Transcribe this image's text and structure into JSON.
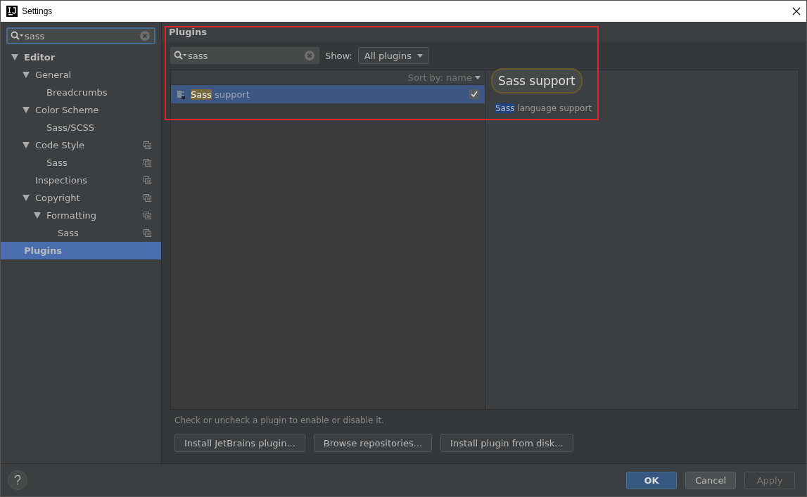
{
  "window": {
    "title": "Settings"
  },
  "search": {
    "value": "sass"
  },
  "tree": [
    {
      "label": "Editor",
      "expanded": true,
      "project_level": false,
      "selected": false,
      "children": [
        {
          "label": "General",
          "expanded": true,
          "project_level": false,
          "selected": false,
          "children": [
            {
              "label": "Breadcrumbs",
              "project_level": false,
              "selected": false
            }
          ]
        },
        {
          "label": "Color Scheme",
          "expanded": true,
          "project_level": false,
          "selected": false,
          "children": [
            {
              "label": "Sass/SCSS",
              "project_level": false,
              "selected": false
            }
          ]
        },
        {
          "label": "Code Style",
          "expanded": true,
          "project_level": true,
          "selected": false,
          "children": [
            {
              "label": "Sass",
              "project_level": true,
              "selected": false
            }
          ]
        },
        {
          "label": "Inspections",
          "project_level": true,
          "selected": false
        },
        {
          "label": "Copyright",
          "expanded": true,
          "project_level": true,
          "selected": false,
          "children": [
            {
              "label": "Formatting",
              "expanded": true,
              "project_level": true,
              "selected": false,
              "children": [
                {
                  "label": "Sass",
                  "project_level": true,
                  "selected": false
                }
              ]
            }
          ]
        }
      ]
    },
    {
      "label": "Plugins",
      "project_level": false,
      "selected": true
    }
  ],
  "plugins_page": {
    "title": "Plugins",
    "search": {
      "value": "sass"
    },
    "show_label": "Show:",
    "show_value": "All plugins",
    "sort_label": "Sort by: name",
    "plugins": [
      {
        "name_parts": [
          {
            "text": "Sass",
            "highlighted": true
          },
          {
            "text": " support",
            "highlighted": false
          }
        ],
        "checked": true,
        "selected": true
      }
    ],
    "detail": {
      "title": "Sass support",
      "description_parts": [
        {
          "text": "Sass",
          "highlighted": true
        },
        {
          "text": " language support",
          "highlighted": false
        }
      ]
    },
    "hint": "Check or uncheck a plugin to enable or disable it.",
    "buttons": [
      "Install JetBrains plugin...",
      "Browse repositories...",
      "Install plugin from disk..."
    ]
  },
  "footer": {
    "buttons": [
      {
        "label": "OK",
        "kind": "primary"
      },
      {
        "label": "Cancel",
        "kind": "normal"
      },
      {
        "label": "Apply",
        "kind": "disabled"
      }
    ]
  }
}
